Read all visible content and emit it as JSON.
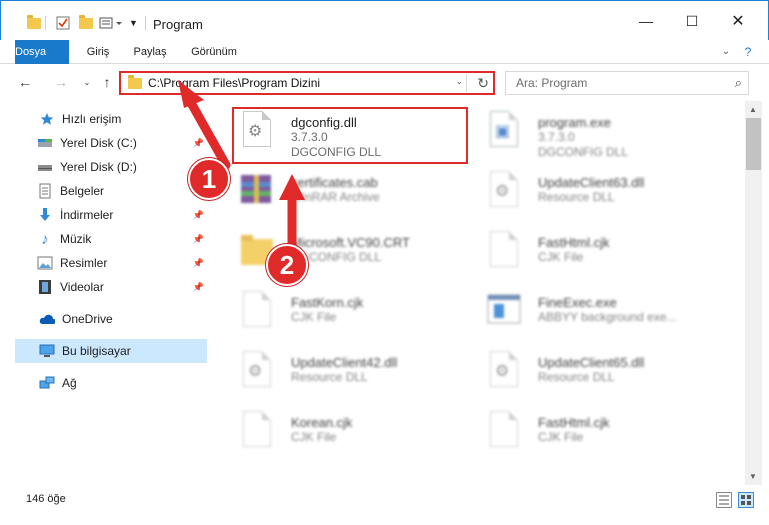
{
  "window": {
    "title": "Program",
    "minimize_icon": "minimize-icon",
    "maximize_icon": "maximize-icon",
    "close_icon": "close-icon"
  },
  "ribbon": {
    "tabs": [
      "Dosya",
      "Giriş",
      "Paylaş",
      "Görünüm"
    ],
    "accent": "#1979ca"
  },
  "nav": {
    "address": "C:\\Program Files\\Program Dizini",
    "search_placeholder": "Ara: Program"
  },
  "sidebar": {
    "items": [
      {
        "label": "Hızlı erişim",
        "icon": "star-icon",
        "pinned": false
      },
      {
        "label": "Yerel Disk (C:)",
        "icon": "drive-icon",
        "pinned": true
      },
      {
        "label": "Yerel Disk (D:)",
        "icon": "drive-icon",
        "pinned": true
      },
      {
        "label": "Belgeler",
        "icon": "documents-icon",
        "pinned": true
      },
      {
        "label": "İndirmeler",
        "icon": "download-icon",
        "pinned": true
      },
      {
        "label": "Müzik",
        "icon": "music-icon",
        "pinned": true
      },
      {
        "label": "Resimler",
        "icon": "pictures-icon",
        "pinned": true
      },
      {
        "label": "Videolar",
        "icon": "videos-icon",
        "pinned": true
      },
      {
        "label": "OneDrive",
        "icon": "cloud-icon",
        "pinned": false
      },
      {
        "label": "Bu bilgisayar",
        "icon": "computer-icon",
        "pinned": false
      },
      {
        "label": "Ağ",
        "icon": "network-icon",
        "pinned": false
      }
    ]
  },
  "files": [
    {
      "name": "dgconfig.dll",
      "line2": "3.7.3.0",
      "line3": "DGCONFIG DLL",
      "highlight": true
    },
    {
      "name": "program.exe",
      "line2": "3.7.3.0",
      "line3": "DGCONFIG DLL"
    },
    {
      "name": "certificates.cab",
      "line2": "WinRAR Archive",
      "line3": ""
    },
    {
      "name": "UpdateClient63.dll",
      "line2": "Resource DLL",
      "line3": ""
    },
    {
      "name": "Microsoft.VC90.CRT",
      "line2": "DGCONFIG DLL",
      "line3": ""
    },
    {
      "name": "FastHtml.cjk",
      "line2": "CJK File",
      "line3": ""
    },
    {
      "name": "FastKorn.cjk",
      "line2": "CJK File",
      "line3": ""
    },
    {
      "name": "FineExec.exe",
      "line2": "ABBYY background exe...",
      "line3": ""
    },
    {
      "name": "UpdateClient42.dll",
      "line2": "Resource DLL",
      "line3": ""
    },
    {
      "name": "UpdateClient65.dll",
      "line2": "Resource DLL",
      "line3": ""
    },
    {
      "name": "Korean.cjk",
      "line2": "CJK File",
      "line3": ""
    },
    {
      "name": "FastHtml.cjk",
      "line2": "CJK File",
      "line3": ""
    }
  ],
  "status": {
    "count": "146 öğe"
  },
  "annotations": {
    "badge1": "1",
    "badge2": "2",
    "color": "#e02a2a"
  }
}
